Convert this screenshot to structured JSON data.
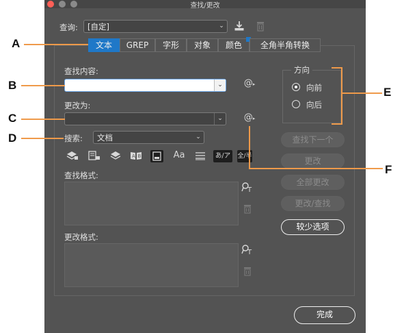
{
  "window": {
    "title": "查找/更改"
  },
  "query": {
    "label": "查询:",
    "value": "[自定]"
  },
  "tabs": [
    {
      "label": "文本"
    },
    {
      "label": "GREP"
    },
    {
      "label": "字形"
    },
    {
      "label": "对象"
    },
    {
      "label": "颜色"
    },
    {
      "label": "全角半角转换"
    }
  ],
  "find": {
    "label": "查找内容:",
    "value": ""
  },
  "change": {
    "label": "更改为:",
    "value": ""
  },
  "search": {
    "label": "搜索:",
    "value": "文档"
  },
  "options": {
    "aa": "Aa",
    "kana": "あ/ア",
    "width": "全/半"
  },
  "direction": {
    "label": "方向",
    "forward": "向前",
    "backward": "向后",
    "selected": "forward"
  },
  "buttons": {
    "find_next": "查找下一个",
    "change": "更改",
    "change_all": "全部更改",
    "change_find": "更改/查找",
    "fewer_options": "较少选项",
    "done": "完成"
  },
  "formats": {
    "find_label": "查找格式:",
    "change_label": "更改格式:"
  },
  "callouts": [
    "A",
    "B",
    "C",
    "D",
    "E",
    "F"
  ],
  "colors": {
    "dialog_bg": "#535353",
    "callout_line": "#ef9a4a",
    "focus_border": "#6aa6e8",
    "active_tab": "#1f78c8"
  }
}
